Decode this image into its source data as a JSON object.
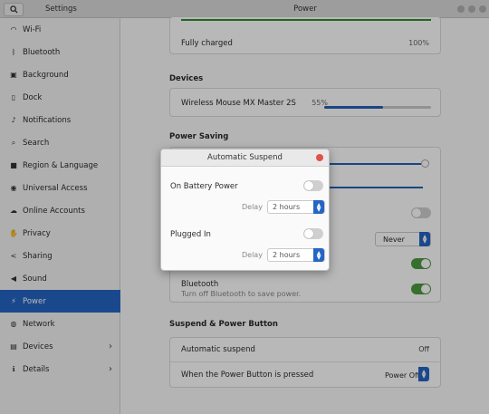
{
  "window": {
    "app_title": "Settings",
    "panel_title": "Power"
  },
  "sidebar": {
    "items": [
      {
        "label": "Wi-Fi",
        "icon": "wifi-icon",
        "glyph": "◠"
      },
      {
        "label": "Bluetooth",
        "icon": "bluetooth-icon",
        "glyph": "ᛒ"
      },
      {
        "label": "Background",
        "icon": "background-icon",
        "glyph": "▣"
      },
      {
        "label": "Dock",
        "icon": "dock-icon",
        "glyph": "▯"
      },
      {
        "label": "Notifications",
        "icon": "bell-icon",
        "glyph": "♪"
      },
      {
        "label": "Search",
        "icon": "search-icon",
        "glyph": "⌕"
      },
      {
        "label": "Region & Language",
        "icon": "camera-icon",
        "glyph": "■"
      },
      {
        "label": "Universal Access",
        "icon": "accessibility-icon",
        "glyph": "◉"
      },
      {
        "label": "Online Accounts",
        "icon": "cloud-icon",
        "glyph": "☁"
      },
      {
        "label": "Privacy",
        "icon": "hand-icon",
        "glyph": "✋"
      },
      {
        "label": "Sharing",
        "icon": "share-icon",
        "glyph": "<"
      },
      {
        "label": "Sound",
        "icon": "speaker-icon",
        "glyph": "◀"
      },
      {
        "label": "Power",
        "icon": "power-icon",
        "glyph": "⚡"
      },
      {
        "label": "Network",
        "icon": "network-icon",
        "glyph": "◍"
      },
      {
        "label": "Devices",
        "icon": "printer-icon",
        "glyph": "▤"
      },
      {
        "label": "Details",
        "icon": "info-icon",
        "glyph": "ℹ"
      }
    ],
    "active": "Power"
  },
  "battery": {
    "status": "Fully charged",
    "percent": "100%",
    "level": 1.0
  },
  "devices": {
    "title": "Devices",
    "items": [
      {
        "name": "Wireless Mouse MX Master 2S",
        "percent": "55%",
        "level": 0.55
      }
    ]
  },
  "power_saving": {
    "title": "Power Saving",
    "blank_screen_value": "Never",
    "bluetooth_label": "Bluetooth",
    "bluetooth_sub": "Turn off Bluetooth to save power."
  },
  "suspend": {
    "title": "Suspend & Power Button",
    "automatic_suspend_label": "Automatic suspend",
    "automatic_suspend_value": "Off",
    "power_button_label": "When the Power Button is pressed",
    "power_button_value": "Power Off"
  },
  "dialog": {
    "title": "Automatic Suspend",
    "on_battery_label": "On Battery Power",
    "plugged_in_label": "Plugged In",
    "delay_label": "Delay",
    "battery_delay": "2 hours",
    "plugged_delay": "2 hours"
  },
  "colors": {
    "accent": "#2565c4",
    "toggle_on": "#4d9a3d",
    "close_red": "#e0524c",
    "battery_green": "#2f8f2f"
  }
}
